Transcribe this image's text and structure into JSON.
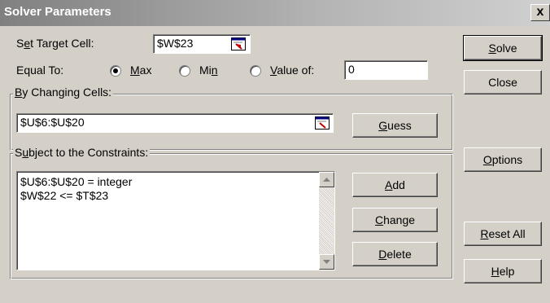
{
  "window": {
    "title": "Solver Parameters",
    "close_glyph": "x"
  },
  "target": {
    "label_pre": "S",
    "label_u": "e",
    "label_post": "t Target Cell:",
    "value": "$W$23"
  },
  "equal_to": {
    "label": "Equal To:",
    "options": [
      {
        "pre": "",
        "u": "M",
        "post": "ax",
        "selected": true
      },
      {
        "pre": "Mi",
        "u": "n",
        "post": "",
        "selected": false
      },
      {
        "pre": "",
        "u": "V",
        "post": "alue of:",
        "selected": false
      }
    ],
    "value_of": "0"
  },
  "changing": {
    "label_pre": "",
    "label_u": "B",
    "label_post": "y Changing Cells:",
    "value": "$U$6:$U$20"
  },
  "constraints": {
    "label_pre": "S",
    "label_u": "u",
    "label_post": "bject to the Constraints:",
    "items": [
      "$U$6:$U$20 = integer",
      "$W$22 <= $T$23"
    ]
  },
  "buttons": {
    "solve": {
      "pre": "",
      "u": "S",
      "post": "olve"
    },
    "close": {
      "label": "Close"
    },
    "guess": {
      "pre": "",
      "u": "G",
      "post": "uess"
    },
    "options": {
      "pre": "",
      "u": "O",
      "post": "ptions"
    },
    "add": {
      "pre": "",
      "u": "A",
      "post": "dd"
    },
    "change": {
      "pre": "",
      "u": "C",
      "post": "hange"
    },
    "delete": {
      "pre": "",
      "u": "D",
      "post": "elete"
    },
    "reset": {
      "pre": "",
      "u": "R",
      "post": "eset All"
    },
    "help": {
      "pre": "",
      "u": "H",
      "post": "elp"
    }
  },
  "icons": {
    "cell_ref": "collapse-dialog-icon",
    "scroll_up": "scroll-up-icon",
    "scroll_down": "scroll-down-icon"
  }
}
